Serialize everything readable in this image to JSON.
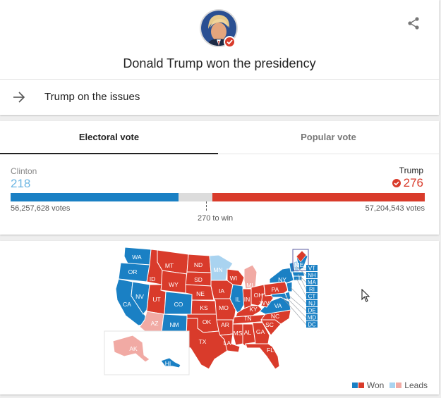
{
  "header": {
    "headline": "Donald Trump won the presidency",
    "link_label": "Trump on the issues",
    "share_icon": "share-icon",
    "arrow_icon": "arrow-right-icon"
  },
  "tabs": [
    {
      "label": "Electoral vote",
      "selected": true
    },
    {
      "label": "Popular vote",
      "selected": false
    }
  ],
  "results": {
    "clinton": {
      "name": "Clinton",
      "electoral_votes": "218",
      "popular_votes": "56,257,628 votes",
      "color": "#1a80c4"
    },
    "trump": {
      "name": "Trump",
      "electoral_votes": "276",
      "popular_votes": "57,204,543 votes",
      "color": "#d93b2b",
      "winner": true
    },
    "threshold_label": "270 to win",
    "total_electoral_votes": 538
  },
  "map": {
    "states": {
      "clinton_won": [
        "WA",
        "OR",
        "CA",
        "NV",
        "CO",
        "NM",
        "IL",
        "VA",
        "MD",
        "DE",
        "NJ",
        "NY",
        "CT",
        "RI",
        "MA",
        "VT",
        "DC",
        "HI"
      ],
      "clinton_leads": [
        "MN",
        "NH"
      ],
      "trump_won": [
        "ID",
        "MT",
        "WY",
        "UT",
        "ND",
        "SD",
        "NE",
        "KS",
        "OK",
        "TX",
        "IA",
        "MO",
        "AR",
        "LA",
        "WI",
        "MS",
        "AL",
        "GA",
        "FL",
        "SC",
        "NC",
        "TN",
        "KY",
        "IN",
        "OH",
        "WV",
        "PA"
      ],
      "trump_leads": [
        "AZ",
        "MI",
        "AK"
      ],
      "split": [
        "ME"
      ]
    },
    "northeast_labels": [
      "VT",
      "NH",
      "MA",
      "RI",
      "CT",
      "NJ",
      "DE",
      "MD",
      "DC"
    ],
    "legend": {
      "won": "Won",
      "leads": "Leads"
    },
    "colors": {
      "clinton_won": "#1a80c4",
      "clinton_leads": "#a9d3f0",
      "trump_won": "#d93b2b",
      "trump_leads": "#f1aaa4"
    }
  }
}
